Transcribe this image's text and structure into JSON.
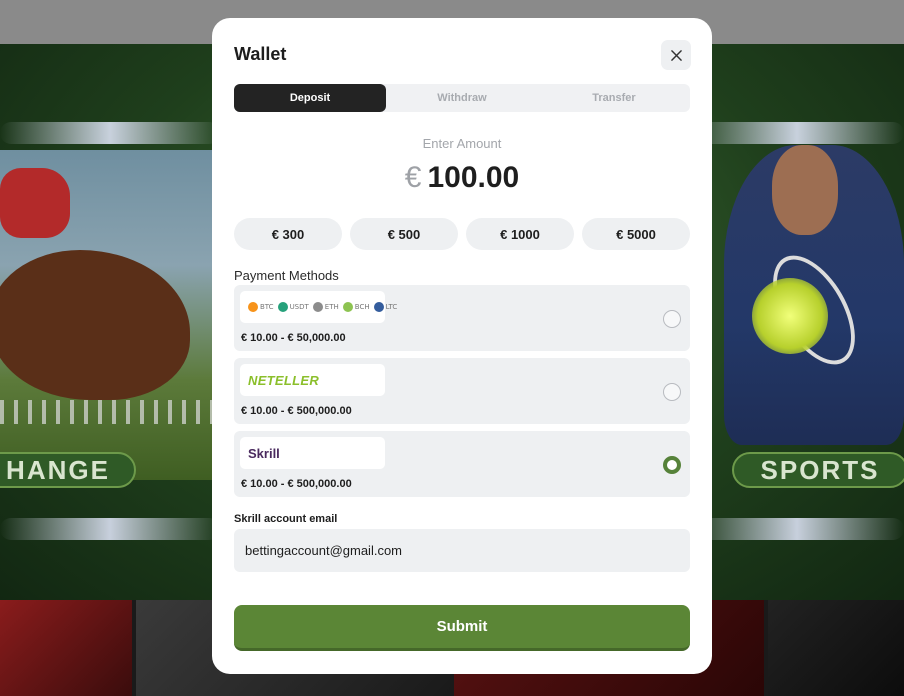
{
  "background": {
    "left_banner_label": "HANGE",
    "right_banner_label": "SPORTS"
  },
  "wallet": {
    "title": "Wallet",
    "close_icon": "close-icon",
    "tabs": [
      {
        "label": "Deposit",
        "active": true
      },
      {
        "label": "Withdraw",
        "active": false
      },
      {
        "label": "Transfer",
        "active": false
      }
    ],
    "amount": {
      "label": "Enter Amount",
      "currency": "€",
      "value": "100.00"
    },
    "presets": [
      "€ 300",
      "€ 500",
      "€ 1000",
      "€ 5000"
    ],
    "payment_methods": {
      "label": "Payment Methods",
      "items": [
        {
          "name": "crypto",
          "coins": [
            {
              "tag": "BTC",
              "color": "#f7931a"
            },
            {
              "tag": "USDT",
              "color": "#26a17b"
            },
            {
              "tag": "ETH",
              "color": "#8c8c8c"
            },
            {
              "tag": "BCH",
              "color": "#8dc351"
            },
            {
              "tag": "LTC",
              "color": "#345d9d"
            }
          ],
          "range": "€ 10.00 - € 50,000.00",
          "selected": false
        },
        {
          "name": "NETELLER",
          "range": "€ 10.00 - € 500,000.00",
          "selected": false
        },
        {
          "name": "Skrill",
          "range": "€ 10.00 - € 500,000.00",
          "selected": true
        }
      ]
    },
    "email": {
      "label": "Skrill account email",
      "value": "bettingaccount@gmail.com"
    },
    "submit_label": "Submit",
    "colors": {
      "accent": "#5b8636",
      "active_tab": "#232323",
      "field_bg": "#eef0f2"
    }
  }
}
